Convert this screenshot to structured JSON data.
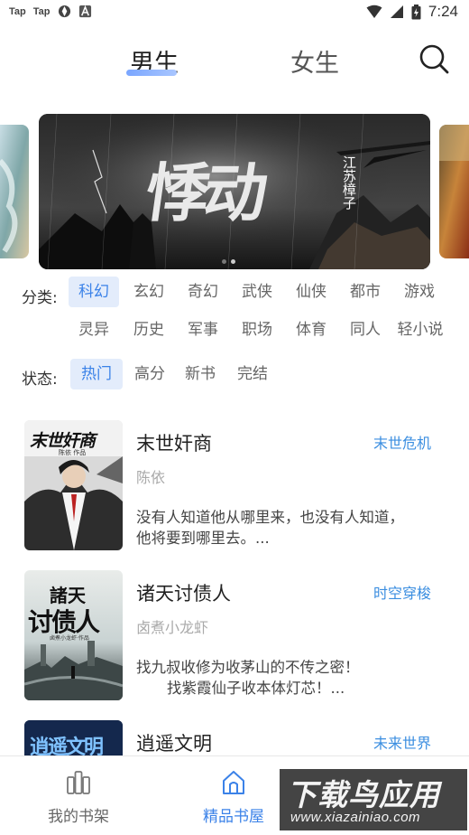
{
  "status_bar": {
    "app1": "Tap",
    "app2": "Tap",
    "time": "7:24"
  },
  "tabs": [
    {
      "label": "男生",
      "selected": true
    },
    {
      "label": "女生",
      "selected": false
    }
  ],
  "banner": {
    "title": "悸动",
    "author": "江苏樟子"
  },
  "category": {
    "label": "分类:",
    "items": [
      "科幻",
      "玄幻",
      "奇幻",
      "武侠",
      "仙侠",
      "都市",
      "游戏",
      "灵异",
      "历史",
      "军事",
      "职场",
      "体育",
      "同人",
      "轻小说"
    ],
    "selected": "科幻"
  },
  "status": {
    "label": "状态:",
    "items": [
      "热门",
      "高分",
      "新书",
      "完结"
    ],
    "selected": "热门"
  },
  "books": [
    {
      "title": "末世奸商",
      "author": "陈依",
      "tag": "末世危机",
      "desc_line1": "没有人知道他从哪里来，也没有人知道，",
      "desc_line2": "他将要到哪里去。...",
      "cover_text": "末世奸商",
      "cover_sub": "陈依 作品"
    },
    {
      "title": "诸天讨债人",
      "author": "卤煮小龙虾",
      "tag": "时空穿梭",
      "desc_line1": "找九叔收修为收茅山的不传之密！",
      "desc_line2": "找紫霞仙子收本体灯芯！...",
      "cover_text1": "諸天",
      "cover_text2": "讨债人",
      "cover_sub": "卤煮小龙虾·作品"
    },
    {
      "title": "逍遥文明",
      "author": "",
      "tag": "未来世界",
      "cover_text": "逍遥文明"
    }
  ],
  "bottom_nav": [
    {
      "label": "我的书架",
      "active": false
    },
    {
      "label": "精品书屋",
      "active": true
    }
  ],
  "watermark": {
    "big": "下载鸟应用",
    "small": "www.xiazainiao.com"
  },
  "colors": {
    "accent": "#3b82e8",
    "tag": "#3b8ee0",
    "chip_bg": "#e3ecfb"
  }
}
